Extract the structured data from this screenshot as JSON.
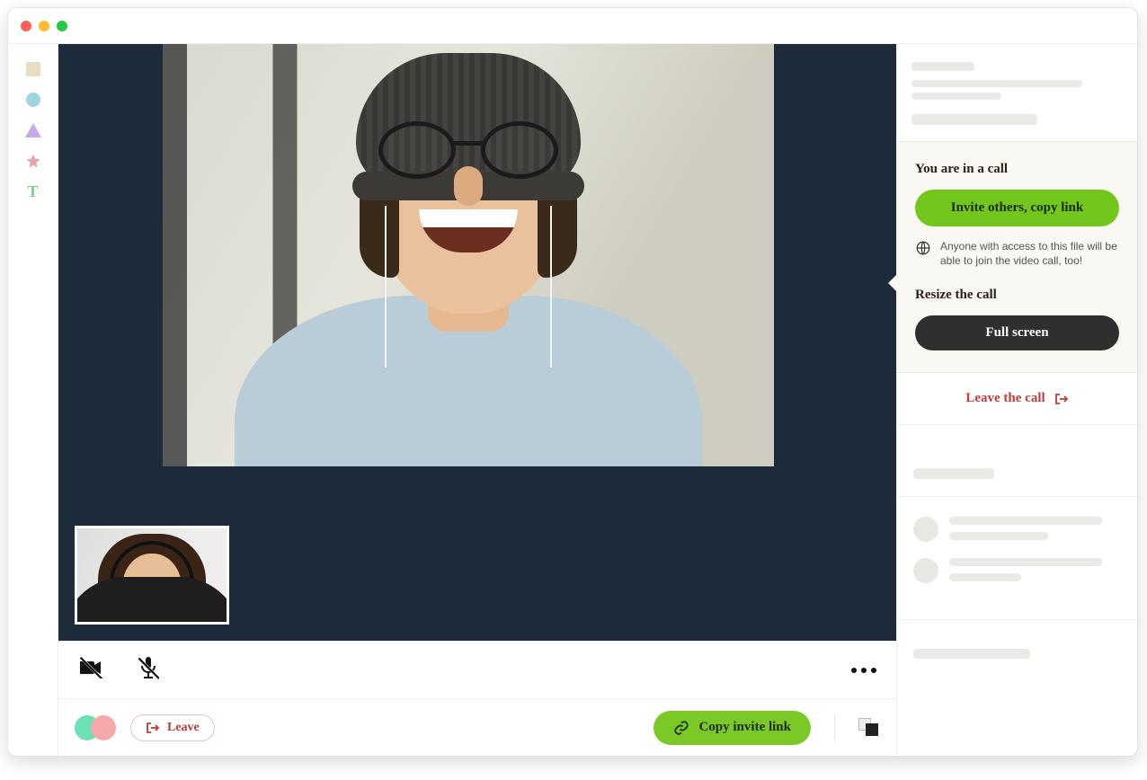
{
  "sidebar_tools": [
    {
      "name": "square-tool"
    },
    {
      "name": "circle-tool"
    },
    {
      "name": "triangle-tool"
    },
    {
      "name": "star-tool"
    },
    {
      "name": "text-tool"
    }
  ],
  "call_panel": {
    "heading": "You are in a call",
    "invite_button": "Invite others, copy link",
    "access_note": "Anyone with access to this file will be able to join the video call, too!",
    "resize_heading": "Resize the call",
    "fullscreen_button": "Full screen",
    "leave_label": "Leave the call"
  },
  "bottom_bar": {
    "leave_label": "Leave",
    "copy_link_label": "Copy invite link"
  },
  "colors": {
    "accent_green": "#73c71c",
    "danger_red": "#c23b3b",
    "stage_bg": "#1d2b3a"
  }
}
